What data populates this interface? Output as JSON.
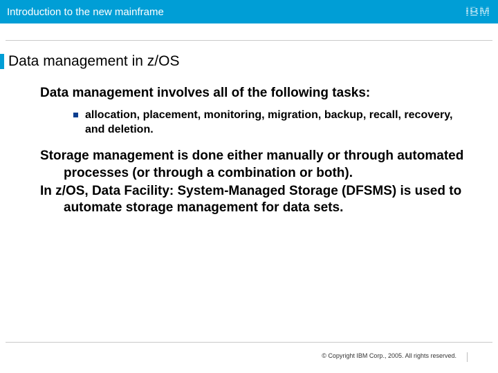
{
  "header": {
    "title": "Introduction to the new mainframe",
    "logo": "IBM"
  },
  "slide": {
    "title": "Data management in z/OS"
  },
  "content": {
    "lead": "Data management involves all of the following tasks:",
    "bullet": "allocation, placement, monitoring, migration, backup, recall, recovery, and deletion.",
    "para1": "Storage management is done either manually or through automated processes (or through a combination or both).",
    "para2": "In z/OS, Data Facility:  System-Managed Storage (DFSMS) is used to automate storage management for data sets."
  },
  "footer": {
    "copyright": "© Copyright IBM Corp., 2005. All rights reserved."
  }
}
